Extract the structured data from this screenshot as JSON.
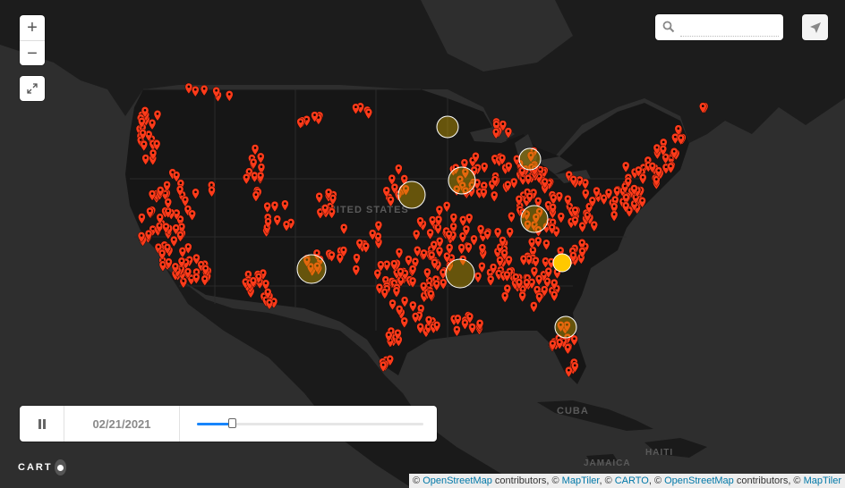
{
  "map": {
    "labels": {
      "country": "UNITED STATES",
      "cuba": "CUBA",
      "jamaica": "JAMAICA",
      "haiti": "HAITI"
    },
    "colors": {
      "marker": "#ff3b1a",
      "cluster_fill": "#c8a000",
      "cluster_highlight": "#ffc800",
      "land": "#1a1a1a",
      "water": "#2e2e2e",
      "borders": "#3a3a3a"
    },
    "legend_note": ""
  },
  "controls": {
    "zoom_in": "+",
    "zoom_out": "−",
    "fullscreen_icon": "expand-icon",
    "search_placeholder": "",
    "search_icon": "search-icon",
    "locate_icon": "navigate-arrow-icon"
  },
  "timeline": {
    "play_state_icon": "pause-icon",
    "date": "02/21/2021",
    "progress": 0.16
  },
  "logo": {
    "text": "CART"
  },
  "attribution": {
    "prefix": "©",
    "link1": "OpenStreetMap",
    "text1": "contributors, ©",
    "link2": "MapTiler",
    "text2": ", ©",
    "link3": "CARTO",
    "text3": ", ©",
    "link4": "OpenStreetMap",
    "text4": "contributors, ©",
    "link5": "MapTiler"
  }
}
